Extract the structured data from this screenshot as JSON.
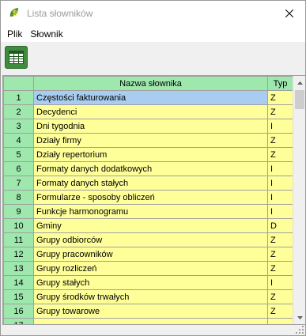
{
  "window": {
    "title": "Lista słowników",
    "app_icon": "dollar-leaf-icon",
    "close_icon": "close-icon"
  },
  "menu": {
    "items": [
      {
        "label": "Plik"
      },
      {
        "label": "Słownik"
      }
    ]
  },
  "toolbar": {
    "button_icon": "table-grid-icon",
    "button_color": "#3f8c3f"
  },
  "grid": {
    "columns": [
      {
        "label": ""
      },
      {
        "label": "Nazwa słownika"
      },
      {
        "label": "Typ"
      }
    ],
    "header_color": "#9ee8ae",
    "cell_color": "#ffff99",
    "selected_color": "#a8cdf0",
    "rows": [
      {
        "num": "1",
        "name": "Częstości fakturowania",
        "typ": "Z"
      },
      {
        "num": "2",
        "name": "Decydenci",
        "typ": "Z"
      },
      {
        "num": "3",
        "name": "Dni tygodnia",
        "typ": "I"
      },
      {
        "num": "4",
        "name": "Działy firmy",
        "typ": "Z"
      },
      {
        "num": "5",
        "name": "Działy repertorium",
        "typ": "Z"
      },
      {
        "num": "6",
        "name": "Formaty danych dodatkowych",
        "typ": "I"
      },
      {
        "num": "7",
        "name": "Formaty danych stałych",
        "typ": "I"
      },
      {
        "num": "8",
        "name": "Formularze - sposoby obliczeń",
        "typ": "I"
      },
      {
        "num": "9",
        "name": "Funkcje harmonogramu",
        "typ": "I"
      },
      {
        "num": "10",
        "name": "Gminy",
        "typ": "D"
      },
      {
        "num": "11",
        "name": "Grupy odbiorców",
        "typ": "Z"
      },
      {
        "num": "12",
        "name": "Grupy pracowników",
        "typ": "Z"
      },
      {
        "num": "13",
        "name": "Grupy rozliczeń",
        "typ": "Z"
      },
      {
        "num": "14",
        "name": "Grupy stałych",
        "typ": "I"
      },
      {
        "num": "15",
        "name": "Grupy środków trwałych",
        "typ": "Z"
      },
      {
        "num": "16",
        "name": "Grupy towarowe",
        "typ": "Z"
      },
      {
        "num": "17",
        "name": "",
        "typ": ""
      }
    ],
    "selected_row": 0
  },
  "scrollbar": {
    "up_icon": "scroll-up-arrow-icon",
    "down_icon": "scroll-down-arrow-icon"
  }
}
